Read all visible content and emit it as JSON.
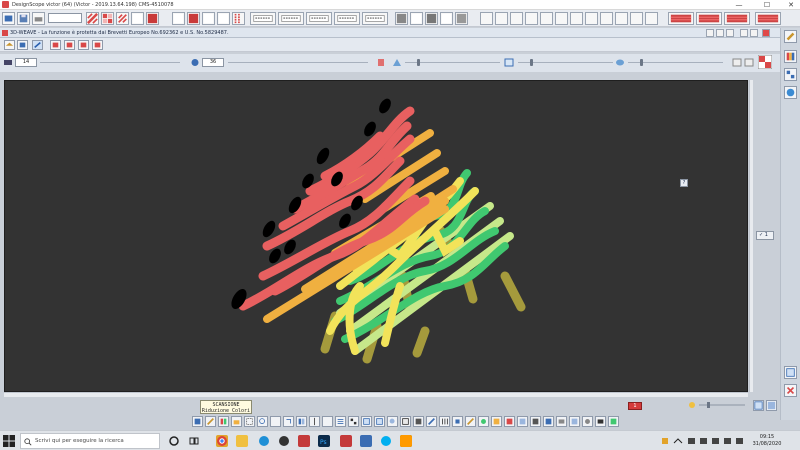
{
  "window": {
    "title": "DesignScope victor (64) (Victor - 2019.13.64.198) CMS-4510078",
    "controls": {
      "minimize": "—",
      "maximize": "☐",
      "close": "✕"
    }
  },
  "child_window": {
    "title": "3D-WEAVE - La funzione è protetta dai Brevetti Europeo No.692362 e U.S. No.5829487."
  },
  "toolbar3": {
    "field1_value": "14",
    "field2_value": "36"
  },
  "viewport": {
    "background": "#333333",
    "help_label": "?",
    "zoom_label": "✓ 1"
  },
  "statusbar": {
    "tooltip_line1": "SCANSIONE",
    "tooltip_line2": "Riduzione Colori",
    "red_badge": "1"
  },
  "taskbar": {
    "search_placeholder": "Scrivi qui per eseguire la ricerca",
    "time": "09:15",
    "date": "31/08/2020",
    "icons": [
      "task-view-icon",
      "edge-icon",
      "file-explorer-icon",
      "chrome-icon",
      "edge-new-icon",
      "media-icon",
      "designscope-icon",
      "photoshop-icon",
      "mail-icon",
      "notes-icon",
      "skype-icon",
      "chat-icon",
      "word-icon",
      "illustrator-icon"
    ]
  },
  "colors": {
    "accent_red": "#d94848",
    "yarn_red": "#e86060",
    "yarn_orange": "#f0b040",
    "yarn_yellow": "#f2e35a",
    "yarn_green": "#40c870",
    "yarn_olive": "#a59a3c"
  }
}
